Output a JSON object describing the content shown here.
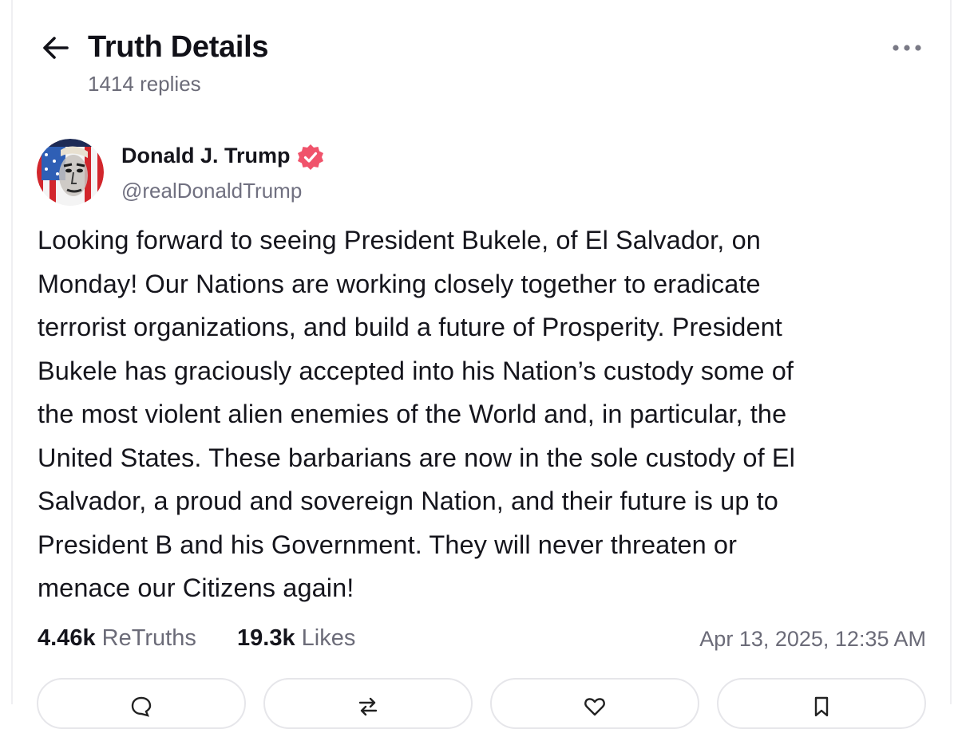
{
  "header": {
    "title": "Truth Details",
    "reply_count": "1414 replies"
  },
  "author": {
    "name": "Donald J. Trump",
    "handle": "@realDonaldTrump",
    "verified_color": "#f0536b"
  },
  "post": {
    "lines": [
      "Looking forward to seeing President Bukele, of El Salvador, on",
      "Monday! Our Nations are working closely together to eradicate",
      "terrorist organizations, and build a future of Prosperity. President",
      "Bukele has graciously accepted into his Nation’s custody some of",
      "the most violent alien enemies of the World and, in particular, the",
      "United States. These barbarians are now in the sole custody of El",
      "Salvador, a proud and sovereign Nation, and their future is up to",
      "President B and his Government. They will never threaten or",
      "menace our Citizens again!"
    ]
  },
  "stats": {
    "retruths_count": "4.46k",
    "retruths_label": "ReTruths",
    "likes_count": "19.3k",
    "likes_label": "Likes",
    "timestamp": "Apr 13, 2025, 12:35 AM"
  },
  "actions": [
    {
      "icon": "reply-icon"
    },
    {
      "icon": "retruth-icon"
    },
    {
      "icon": "like-icon"
    },
    {
      "icon": "bookmark-icon"
    }
  ]
}
